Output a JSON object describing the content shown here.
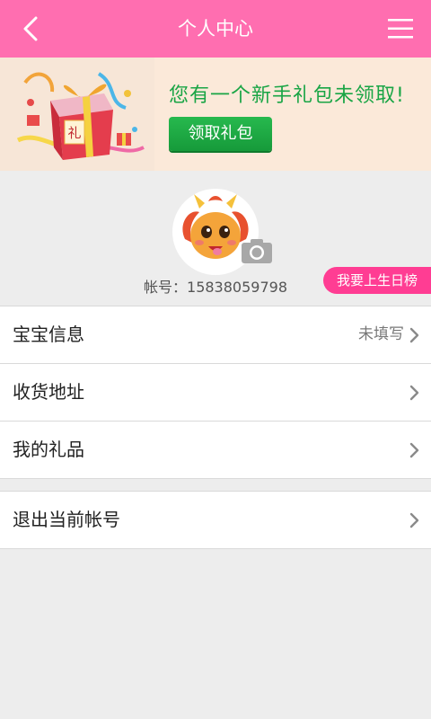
{
  "header": {
    "title": "个人中心",
    "back_icon": "chevron-left-icon",
    "menu_icon": "hamburger-menu-icon",
    "background": "#ff6eb0"
  },
  "banner": {
    "message": "您有一个新手礼包未领取!",
    "button_label": "领取礼包",
    "gift_text": "礼",
    "message_color": "#19a545",
    "button_color": "#1fa845"
  },
  "profile": {
    "account_label": "帐号：",
    "account_number": "15838059798",
    "birthday_button": "我要上生日榜",
    "birthday_color": "#ff3d93",
    "camera_icon": "camera-icon"
  },
  "menu": {
    "items": [
      {
        "label": "宝宝信息",
        "value": "未填写"
      },
      {
        "label": "收货地址",
        "value": ""
      },
      {
        "label": "我的礼品",
        "value": ""
      }
    ],
    "logout": {
      "label": "退出当前帐号"
    }
  }
}
